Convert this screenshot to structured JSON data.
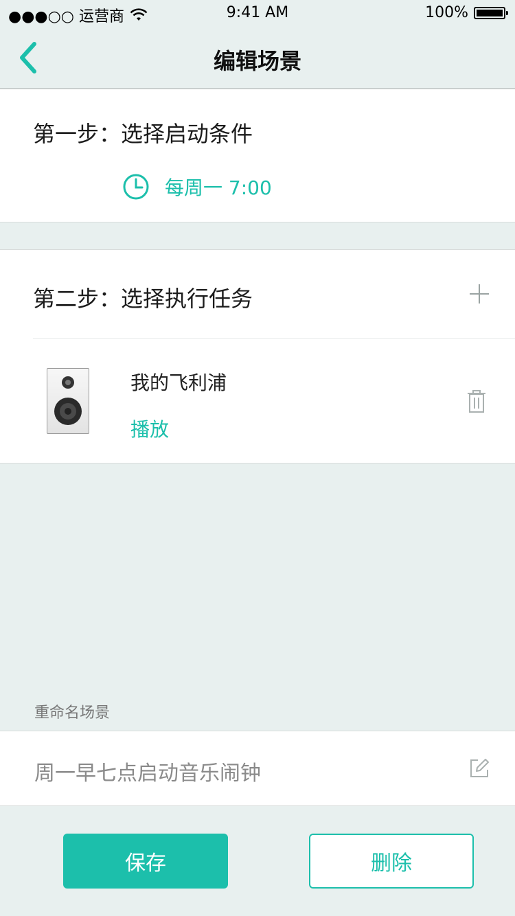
{
  "status_bar": {
    "carrier": "●●●○○ 运营商",
    "time": "9:41 AM",
    "battery": "100%"
  },
  "nav": {
    "title": "编辑场景"
  },
  "step1": {
    "title": "第一步：选择启动条件",
    "condition": "每周一 7:00"
  },
  "step2": {
    "title": "第二步：选择执行任务",
    "device_name": "我的飞利浦",
    "device_action": "播放"
  },
  "rename": {
    "label": "重命名场景",
    "value": "周一早七点启动音乐闹钟"
  },
  "buttons": {
    "save": "保存",
    "delete": "删除"
  },
  "colors": {
    "accent": "#1cbfab",
    "background": "#e8f0ef"
  },
  "icons": {
    "back": "chevron-left-icon",
    "clock": "clock-icon",
    "add": "plus-icon",
    "speaker": "speaker-icon",
    "trash": "trash-icon",
    "edit": "edit-icon",
    "wifi": "wifi-icon",
    "battery": "battery-icon"
  }
}
